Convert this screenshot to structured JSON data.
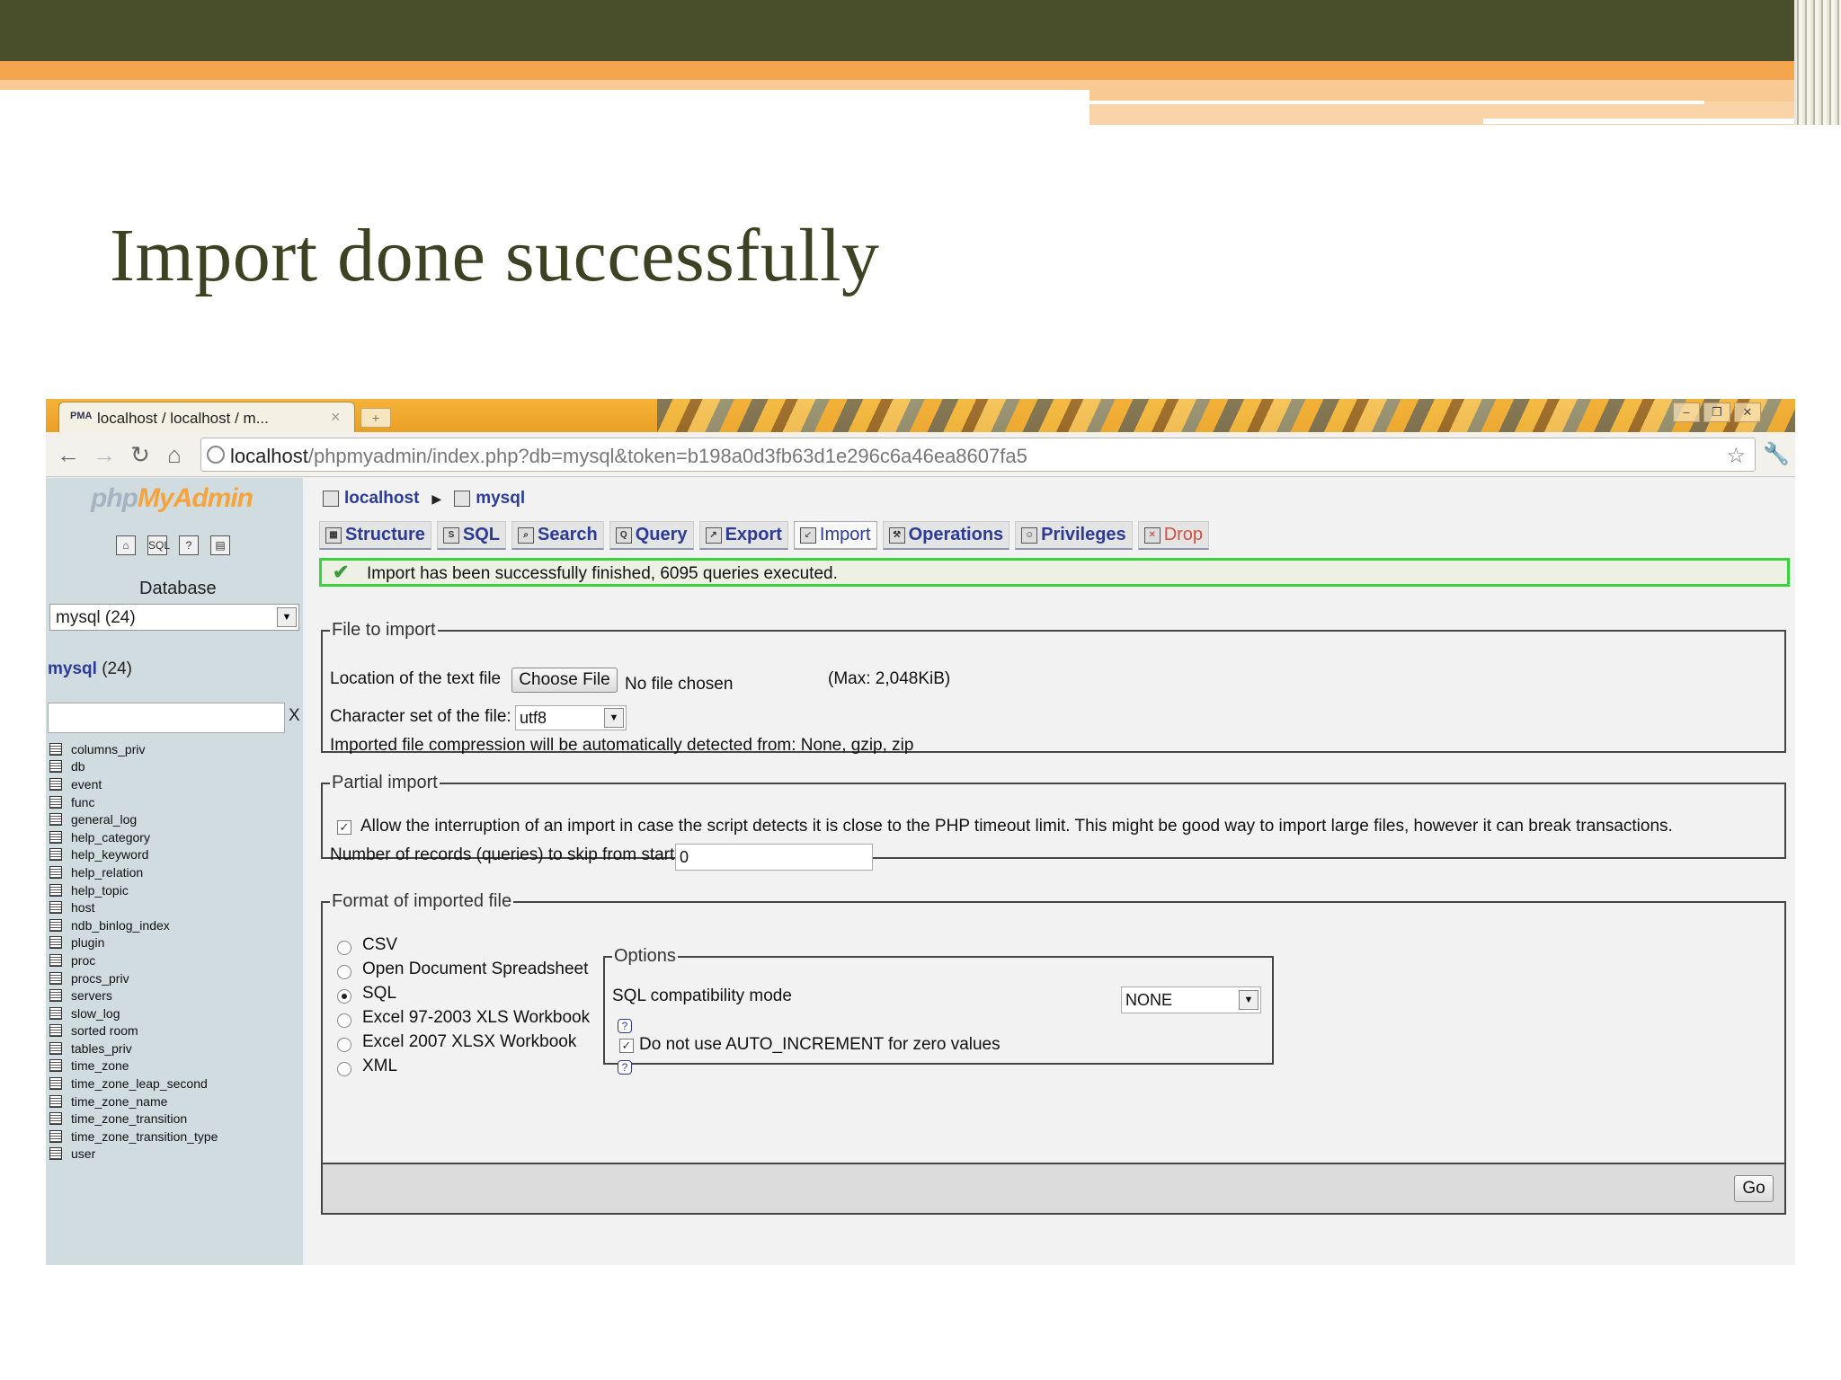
{
  "slide": {
    "title": "Import done successfully"
  },
  "browser": {
    "tab_title": "localhost / localhost / m...",
    "tab_close": "×",
    "newtab": "+",
    "url_host": "localhost",
    "url_path": "/phpmyadmin/index.php?db=mysql&token=b198a0d3fb63d1e296c6a46ea8607fa5"
  },
  "sidebar": {
    "logo_php": "php",
    "logo_my": "MyAdmin",
    "database_label": "Database",
    "database_select": "mysql (24)",
    "db_link_name": "mysql",
    "db_link_count": "(24)",
    "filter_clear": "X",
    "tables": [
      "columns_priv",
      "db",
      "event",
      "func",
      "general_log",
      "help_category",
      "help_keyword",
      "help_relation",
      "help_topic",
      "host",
      "ndb_binlog_index",
      "plugin",
      "proc",
      "procs_priv",
      "servers",
      "slow_log",
      "sorted room",
      "tables_priv",
      "time_zone",
      "time_zone_leap_second",
      "time_zone_name",
      "time_zone_transition",
      "time_zone_transition_type",
      "user"
    ]
  },
  "breadcrumb": {
    "server": "localhost",
    "database": "mysql"
  },
  "tabs": {
    "structure": "Structure",
    "sql": "SQL",
    "search": "Search",
    "query": "Query",
    "export": "Export",
    "import": "Import",
    "operations": "Operations",
    "privileges": "Privileges",
    "drop": "Drop"
  },
  "message": {
    "success": "Import has been successfully finished, 6095 queries executed."
  },
  "file_to_import": {
    "legend": "File to import",
    "location_label": "Location of the text file",
    "choose_file": "Choose File",
    "no_file": "No file chosen",
    "max": "(Max: 2,048KiB)",
    "charset_label": "Character set of the file:",
    "charset_value": "utf8",
    "compression_note": "Imported file compression will be automatically detected from: None, gzip, zip"
  },
  "partial_import": {
    "legend": "Partial import",
    "allow_interrupt": "Allow the interruption of an import in case the script detects it is close to the PHP timeout limit. This might be good way to import large files, however it can break transactions.",
    "skip_label": "Number of records (queries) to skip from start",
    "skip_value": "0"
  },
  "format": {
    "legend": "Format of imported file",
    "options": [
      "CSV",
      "Open Document Spreadsheet",
      "SQL",
      "Excel 97-2003 XLS Workbook",
      "Excel 2007 XLSX Workbook",
      "XML"
    ],
    "selected": "SQL",
    "options_legend": "Options",
    "compat_label": "SQL compatibility mode",
    "compat_value": "NONE",
    "no_auto_increment": "Do not use AUTO_INCREMENT for zero values"
  },
  "go_button": "Go"
}
